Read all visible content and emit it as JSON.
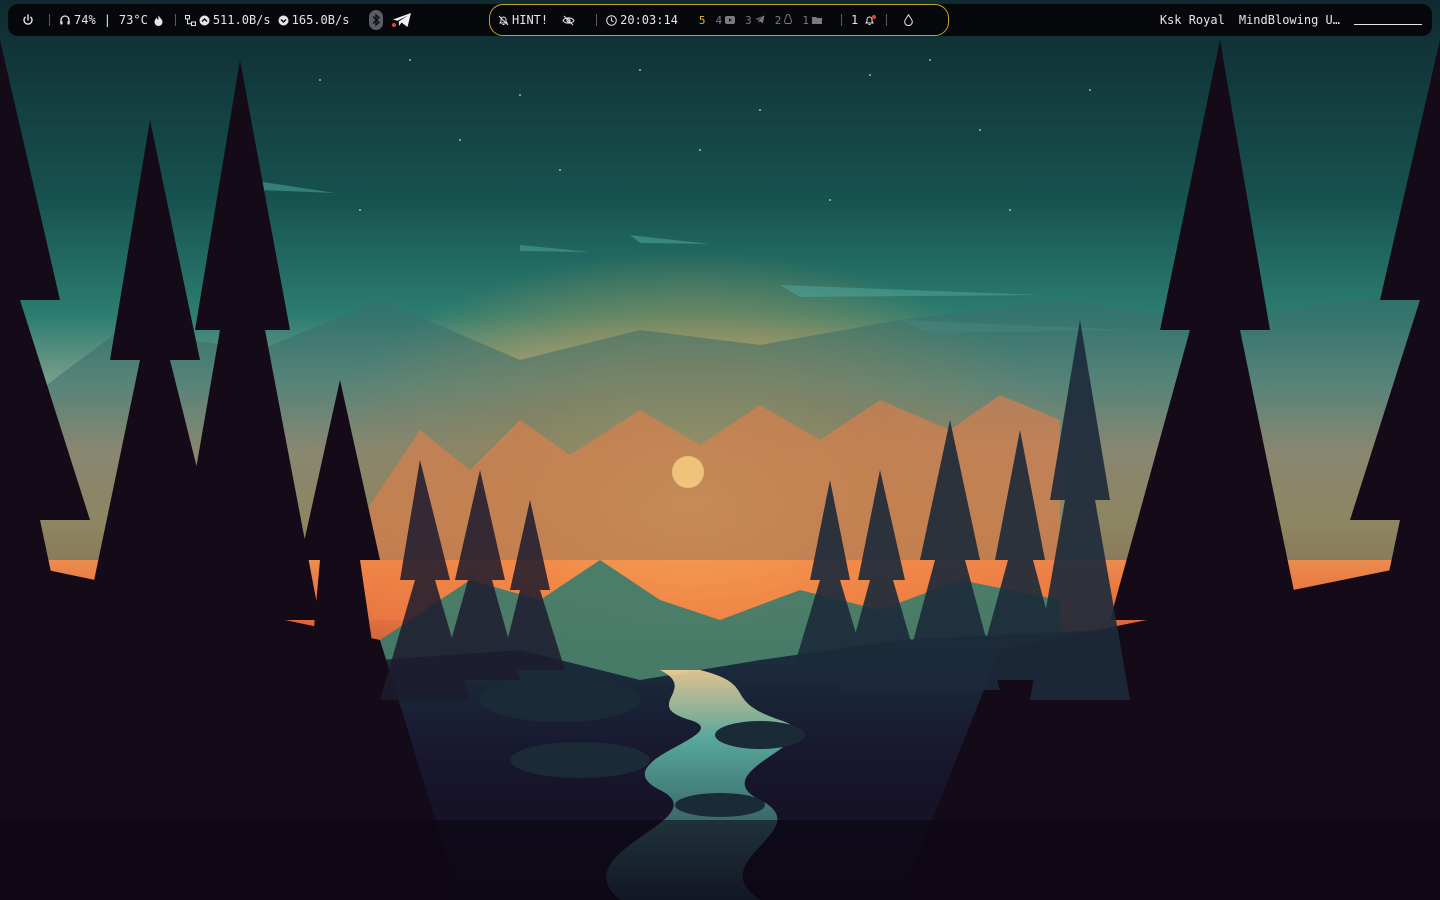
{
  "desktop": {
    "wallpaper_description": "",
    "watermark": ""
  },
  "topbar": {
    "left": {
      "power_icon": "power-icon",
      "volume_icon": "headphones-icon",
      "volume_value": "74%",
      "divider_char": "|",
      "temperature_value": "73°C",
      "temperature_icon": "flame-icon",
      "network_icon": "network-icon",
      "download_icon": "arrow-up-circle-icon",
      "download_speed": "511.0B/s",
      "upload_icon": "arrow-down-circle-icon",
      "upload_speed": "165.0B/s",
      "bluetooth_icon": "bluetooth-icon",
      "telegram_icon": "telegram-icon"
    },
    "center": {
      "hint_icon": "bell-off-icon",
      "hint_label": "HINT!",
      "eye_icon": "eye-off-icon",
      "clock_icon": "clock-icon",
      "time": "20:03:14",
      "workspaces": [
        {
          "number": "5",
          "icon": "",
          "active": true
        },
        {
          "number": "4",
          "icon": "youtube-icon",
          "active": false
        },
        {
          "number": "3",
          "icon": "telegram-icon",
          "active": false
        },
        {
          "number": "2",
          "icon": "tux-icon",
          "active": false
        },
        {
          "number": "1",
          "icon": "folder-icon",
          "active": false
        }
      ],
      "notification_count": "1",
      "notification_icon": "bell-icon",
      "drop_icon": "droplet-icon"
    },
    "right": {
      "media_artist": "Ksk Royal",
      "media_title": "MindBlowing U…"
    }
  },
  "colors": {
    "bar_bg": "#07080b",
    "accent": "#c9a227",
    "active_workspace": "#e4b53b",
    "text": "#e8e6e3",
    "notification_dot": "#e0443b"
  }
}
